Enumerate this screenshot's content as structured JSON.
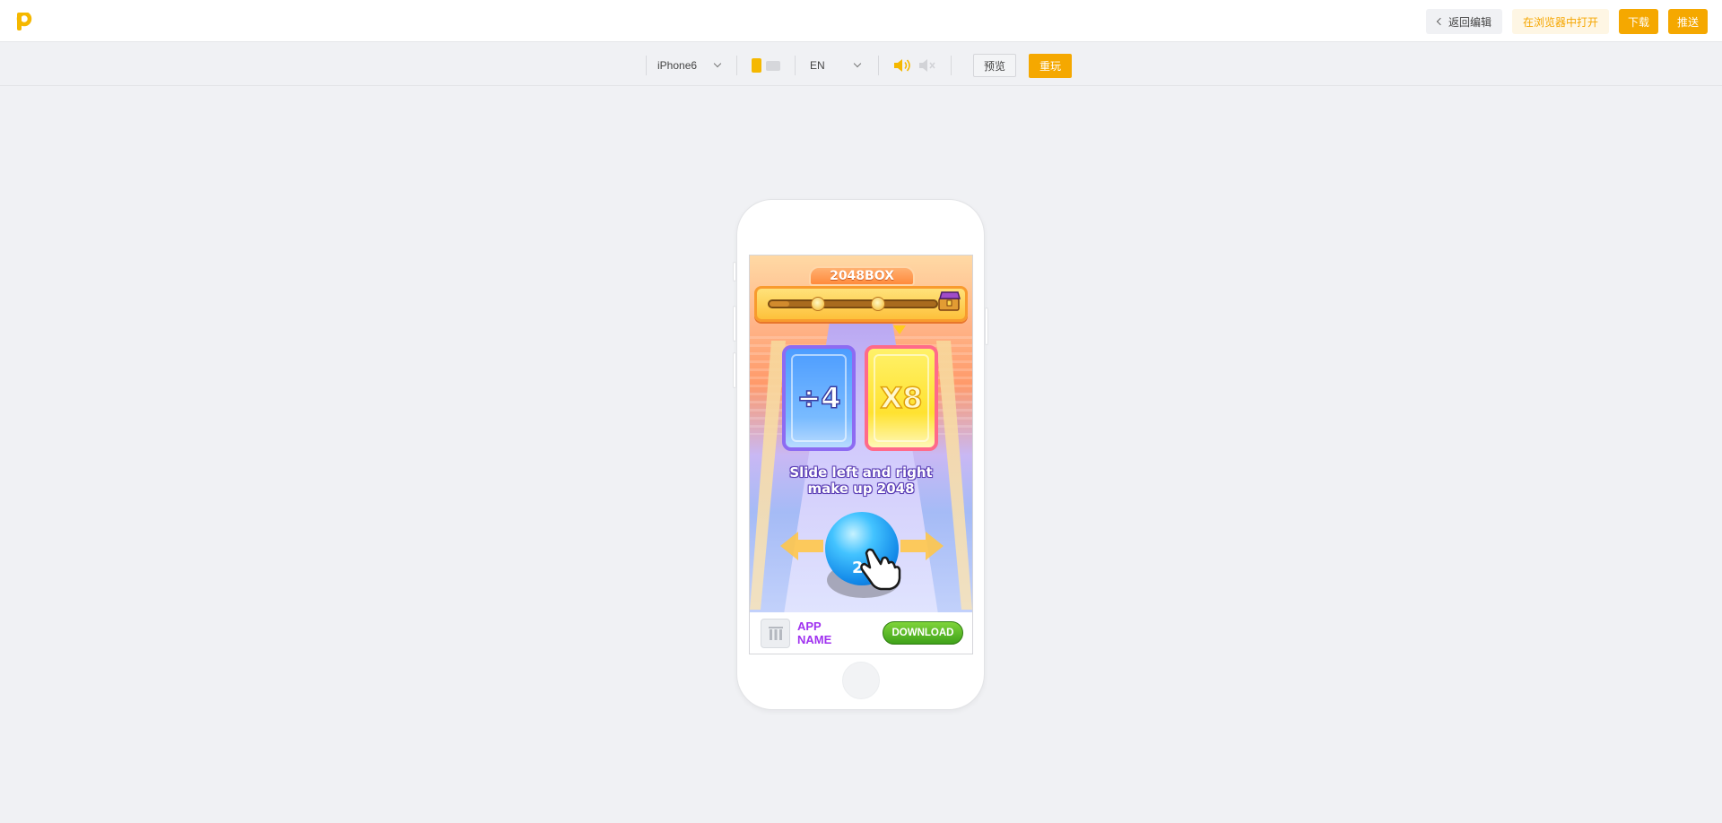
{
  "header": {
    "back_label": "返回编辑",
    "open_browser_label": "在浏览器中打开",
    "download_label": "下载",
    "push_label": "推送",
    "brand_color": "#f5a800"
  },
  "toolbar": {
    "device": "iPhone6",
    "language": "EN",
    "orientation": "portrait",
    "sound": "on",
    "preview_label": "预览",
    "replay_label": "重玩"
  },
  "game": {
    "title": "2048BOX",
    "progress": 0.12,
    "gate_left": "÷4",
    "gate_right": "X8",
    "hint_line1": "Slide left and right",
    "hint_line2": "make up 2048",
    "ball_value": "2"
  },
  "banner": {
    "app_name_line1": "APP",
    "app_name_line2": "NAME",
    "download_label": "DOWNLOAD"
  }
}
